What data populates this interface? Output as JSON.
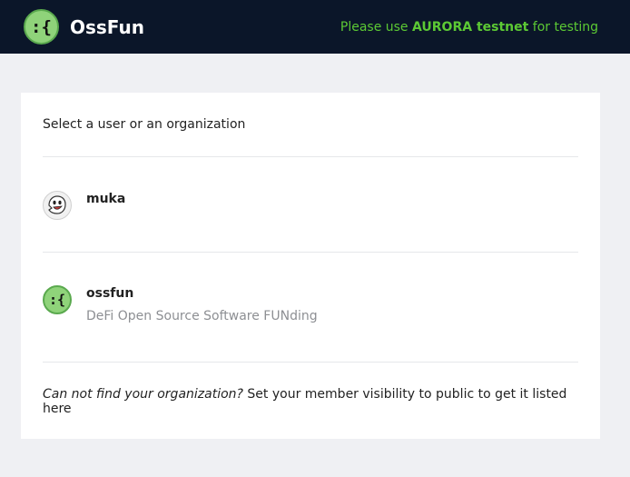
{
  "header": {
    "brand_name": "OssFun",
    "logo_glyph": ":{",
    "notice_prefix": "Please use ",
    "notice_highlight": "AURORA testnet",
    "notice_suffix": " for testing"
  },
  "main": {
    "prompt": "Select a user or an organization",
    "accounts": [
      {
        "name": "muka",
        "description": "",
        "avatar": "ghost-icon"
      },
      {
        "name": "ossfun",
        "description": "DeFi Open Source Software FUNding",
        "avatar_glyph": ":{"
      }
    ],
    "footnote_question": "Can not find your organization?",
    "footnote_text": " Set your member visibility to public to get it listed here"
  },
  "colors": {
    "header_bg": "#0b1629",
    "accent_green": "#5cc934",
    "logo_green": "#8fd37a"
  }
}
